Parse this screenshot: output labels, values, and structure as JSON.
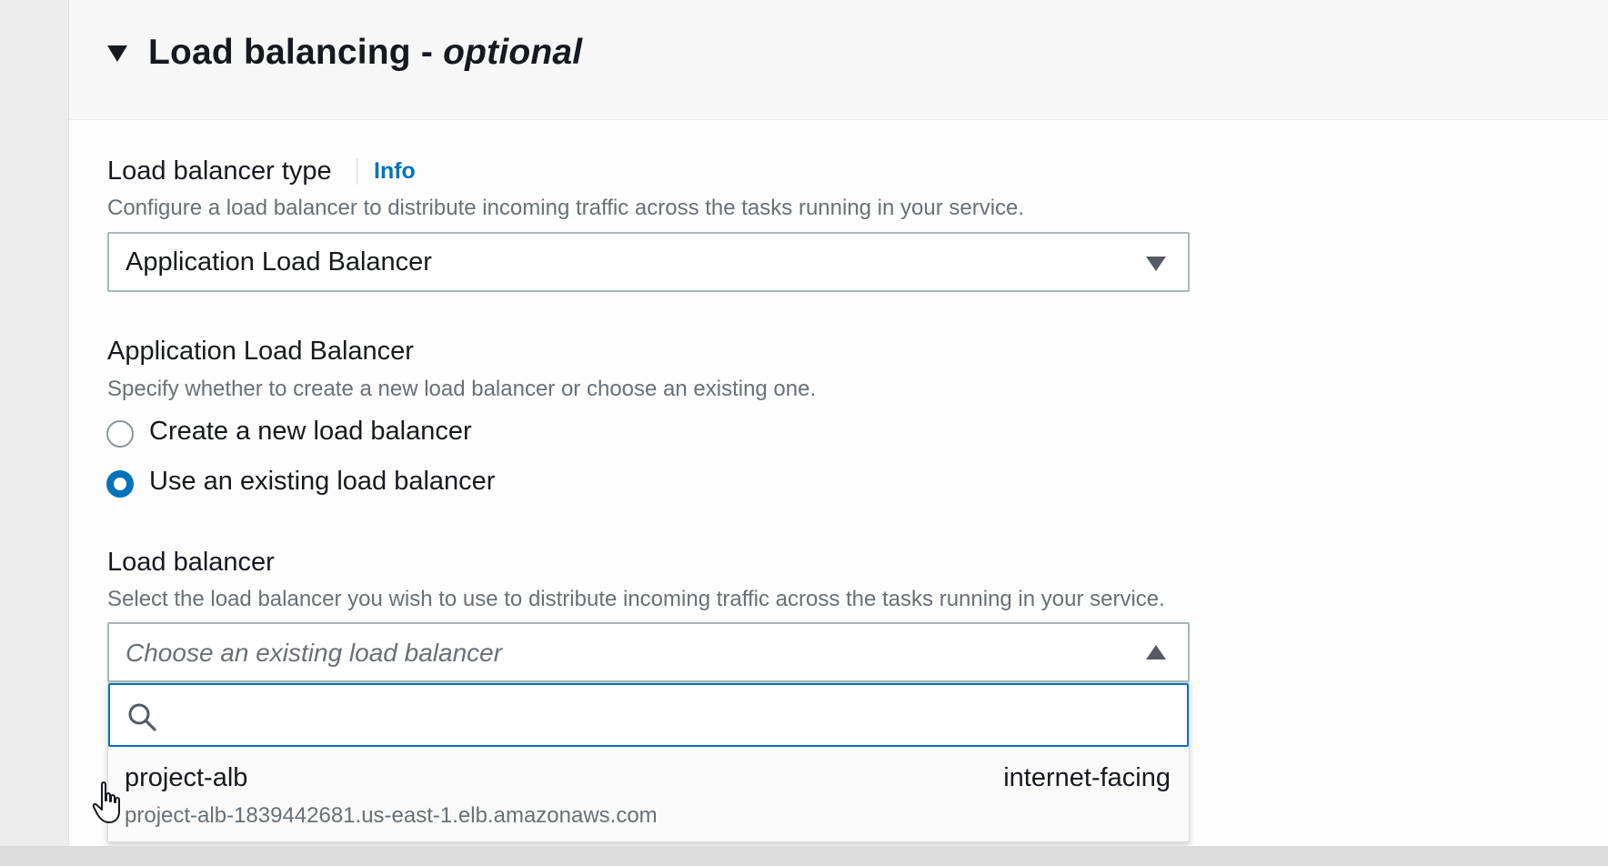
{
  "section": {
    "title": "Load balancing - ",
    "title_suffix": "optional"
  },
  "lb_type": {
    "label": "Load balancer type",
    "info": "Info",
    "description": "Configure a load balancer to distribute incoming traffic across the tasks running in your service.",
    "selected": "Application Load Balancer"
  },
  "alb": {
    "label": "Application Load Balancer",
    "description": "Specify whether to create a new load balancer or choose an existing one.",
    "options": [
      {
        "label": "Create a new load balancer",
        "checked": false
      },
      {
        "label": "Use an existing load balancer",
        "checked": true
      }
    ]
  },
  "load_balancer": {
    "label": "Load balancer",
    "description": "Select the load balancer you wish to use to distribute incoming traffic across the tasks running in your service.",
    "placeholder": "Choose an existing load balancer",
    "search_value": "",
    "items": [
      {
        "name": "project-alb",
        "scheme": "internet-facing",
        "dns": "project-alb-1839442681.us-east-1.elb.amazonaws.com"
      }
    ]
  },
  "colors": {
    "accent": "#0073bb",
    "text": "#16191f",
    "muted": "#687078"
  },
  "icons": {
    "expand": "caret-down-icon",
    "select": "triangle-down-icon",
    "select_open": "triangle-up-icon",
    "search": "search-icon",
    "cursor": "hand-cursor-icon"
  }
}
